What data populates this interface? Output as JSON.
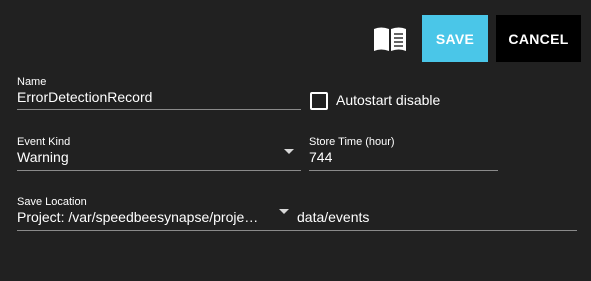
{
  "toolbar": {
    "help_icon": "open-book-icon",
    "save_label": "SAVE",
    "cancel_label": "CANCEL"
  },
  "colors": {
    "background": "#212121",
    "save_button": "#4ac6e8",
    "cancel_button": "#000000",
    "underline": "#8a8a8a"
  },
  "form": {
    "name": {
      "label": "Name",
      "value": "ErrorDetectionRecord"
    },
    "autostart": {
      "label": "Autostart disable",
      "checked": false
    },
    "event_kind": {
      "label": "Event Kind",
      "value": "Warning"
    },
    "store_time": {
      "label": "Store Time (hour)",
      "value": "744"
    },
    "save_location": {
      "label": "Save Location",
      "value": "Project: /var/speedbeesynapse/proje…",
      "path": "data/events"
    }
  }
}
